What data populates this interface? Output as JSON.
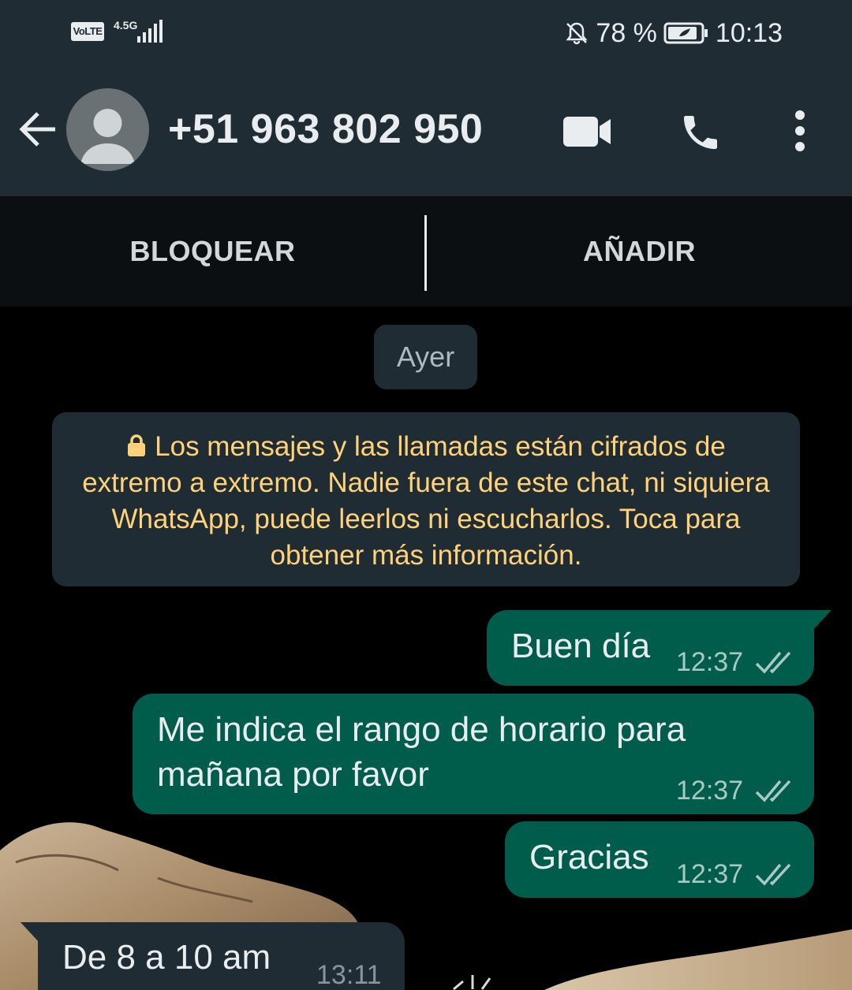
{
  "status": {
    "volte": "VoLTE",
    "network": "4.5G",
    "battery_pct": "78 %",
    "time": "10:13"
  },
  "header": {
    "contact": "+51 963 802 950"
  },
  "actions": {
    "block": "BLOQUEAR",
    "add": "AÑADIR"
  },
  "chat": {
    "date_chip": "Ayer",
    "encryption_notice": "Los mensajes y las llamadas están cifrados de extremo a extremo. Nadie fuera de este chat, ni siquiera WhatsApp, puede leerlos ni escucharlos. Toca para obtener más información.",
    "messages": [
      {
        "direction": "out",
        "text": "Buen día",
        "time": "12:37",
        "status": "read"
      },
      {
        "direction": "out",
        "text_line1": "Me indica el rango de horario para",
        "text_line2": "mañana por favor",
        "time": "12:37",
        "status": "read"
      },
      {
        "direction": "out",
        "text": "Gracias",
        "time": "12:37",
        "status": "read"
      },
      {
        "direction": "in",
        "text": "De 8 a 10 am",
        "time": "13:11"
      }
    ]
  },
  "colors": {
    "header_bg": "#202c33",
    "outgoing_bubble": "#005c4b",
    "incoming_bubble": "#202c33",
    "notice_text": "#ffd279",
    "chat_bg": "#000000"
  }
}
